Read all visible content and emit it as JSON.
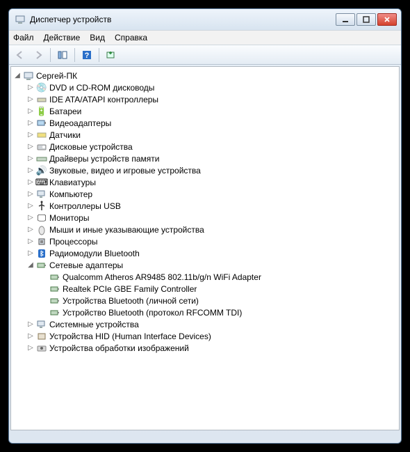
{
  "window": {
    "title": "Диспетчер устройств"
  },
  "menu": {
    "file": "Файл",
    "action": "Действие",
    "view": "Вид",
    "help": "Справка"
  },
  "tree": {
    "root": "Сергей-ПК",
    "cat": {
      "dvd": "DVD и CD-ROM дисководы",
      "ide": "IDE ATA/ATAPI контроллеры",
      "battery": "Батареи",
      "video": "Видеоадаптеры",
      "sensors": "Датчики",
      "disk": "Дисковые устройства",
      "memdrv": "Драйверы устройств памяти",
      "sound": "Звуковые, видео и игровые устройства",
      "keyboard": "Клавиатуры",
      "computer": "Компьютер",
      "usb": "Контроллеры USB",
      "monitor": "Мониторы",
      "mouse": "Мыши и иные указывающие устройства",
      "cpu": "Процессоры",
      "btradio": "Радиомодули Bluetooth",
      "net": "Сетевые адаптеры",
      "system": "Системные устройства",
      "hid": "Устройства HID (Human Interface Devices)",
      "imaging": "Устройства обработки изображений"
    },
    "net_children": {
      "wifi": "Qualcomm Atheros AR9485 802.11b/g/n WiFi Adapter",
      "gbe": "Realtek PCIe GBE Family Controller",
      "btpan": "Устройства Bluetooth (личной сети)",
      "btrfcomm": "Устройство Bluetooth (протокол RFCOMM TDI)"
    }
  }
}
